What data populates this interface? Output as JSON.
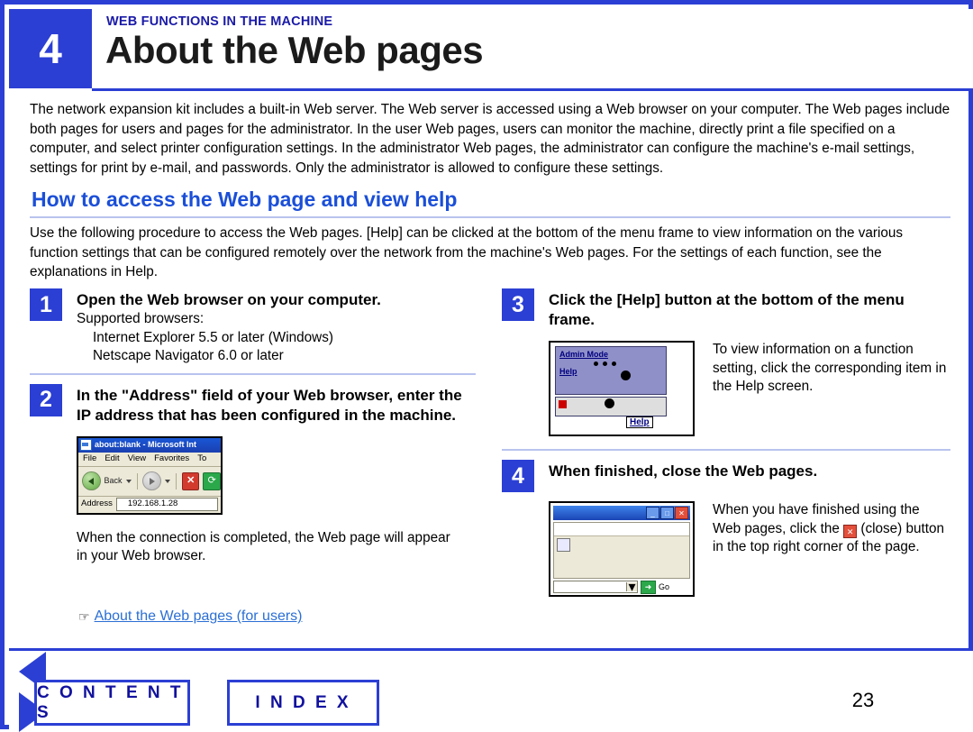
{
  "header": {
    "chapter_number": "4",
    "kicker": "WEB FUNCTIONS IN THE MACHINE",
    "title": "About the Web pages",
    "accent_color": "#2b3fd4"
  },
  "intro": "The network expansion kit includes a built-in Web server. The Web server is accessed using a Web browser on your computer. The Web pages include both pages for users and pages for the administrator. In the user Web pages, users can monitor the machine, directly print a file specified on a computer, and select printer configuration settings. In the administrator Web pages, the administrator can configure the machine's e-mail settings, settings for print by e-mail, and passwords. Only the administrator is allowed to configure these settings.",
  "section": {
    "heading": "How to access the Web page and view help",
    "lead": "Use the following procedure to access the Web pages. [Help] can be clicked at the bottom of the menu frame to view information on the various function settings that can be configured remotely over the network from the machine's Web pages. For the settings of each function, see the explanations in Help."
  },
  "steps": {
    "one": {
      "number": "1",
      "title": "Open the Web browser on your computer.",
      "body_lead": "Supported browsers:",
      "browser1": "Internet Explorer 5.5 or later (Windows)",
      "browser2": "Netscape Navigator 6.0 or later"
    },
    "two": {
      "number": "2",
      "title": "In the \"Address\" field of your Web browser, enter the IP address that has been configured in the machine.",
      "caption": "When the connection is completed, the Web page will appear in your Web browser.",
      "link": "About the Web pages (for users)",
      "browser_mock": {
        "title": "about:blank - Microsoft Int",
        "menu": [
          "File",
          "Edit",
          "View",
          "Favorites",
          "To"
        ],
        "back_label": "Back",
        "address_label": "Address",
        "address_value": "192.168.1.28"
      }
    },
    "three": {
      "number": "3",
      "title": "Click the [Help] button at the bottom of the menu frame.",
      "body": "To view information on a function setting, click the corresponding item in the Help screen.",
      "frame_mock": {
        "admin_label": "Admin Mode",
        "help_link": "Help",
        "help_button": "Help"
      }
    },
    "four": {
      "number": "4",
      "title": "When finished, close the Web pages.",
      "body_before": "When you have finished using the Web pages, click the",
      "body_after": "(close) button in the top right corner of the page.",
      "window_mock": {
        "minimize": "_",
        "maximize": "□",
        "close": "✕",
        "go_label": "Go"
      }
    }
  },
  "footer": {
    "contents": "C O N T E N T S",
    "index": "I N D E X",
    "page_number": "23",
    "prev_icon": "prev-triangle",
    "next_icon": "next-triangle"
  }
}
